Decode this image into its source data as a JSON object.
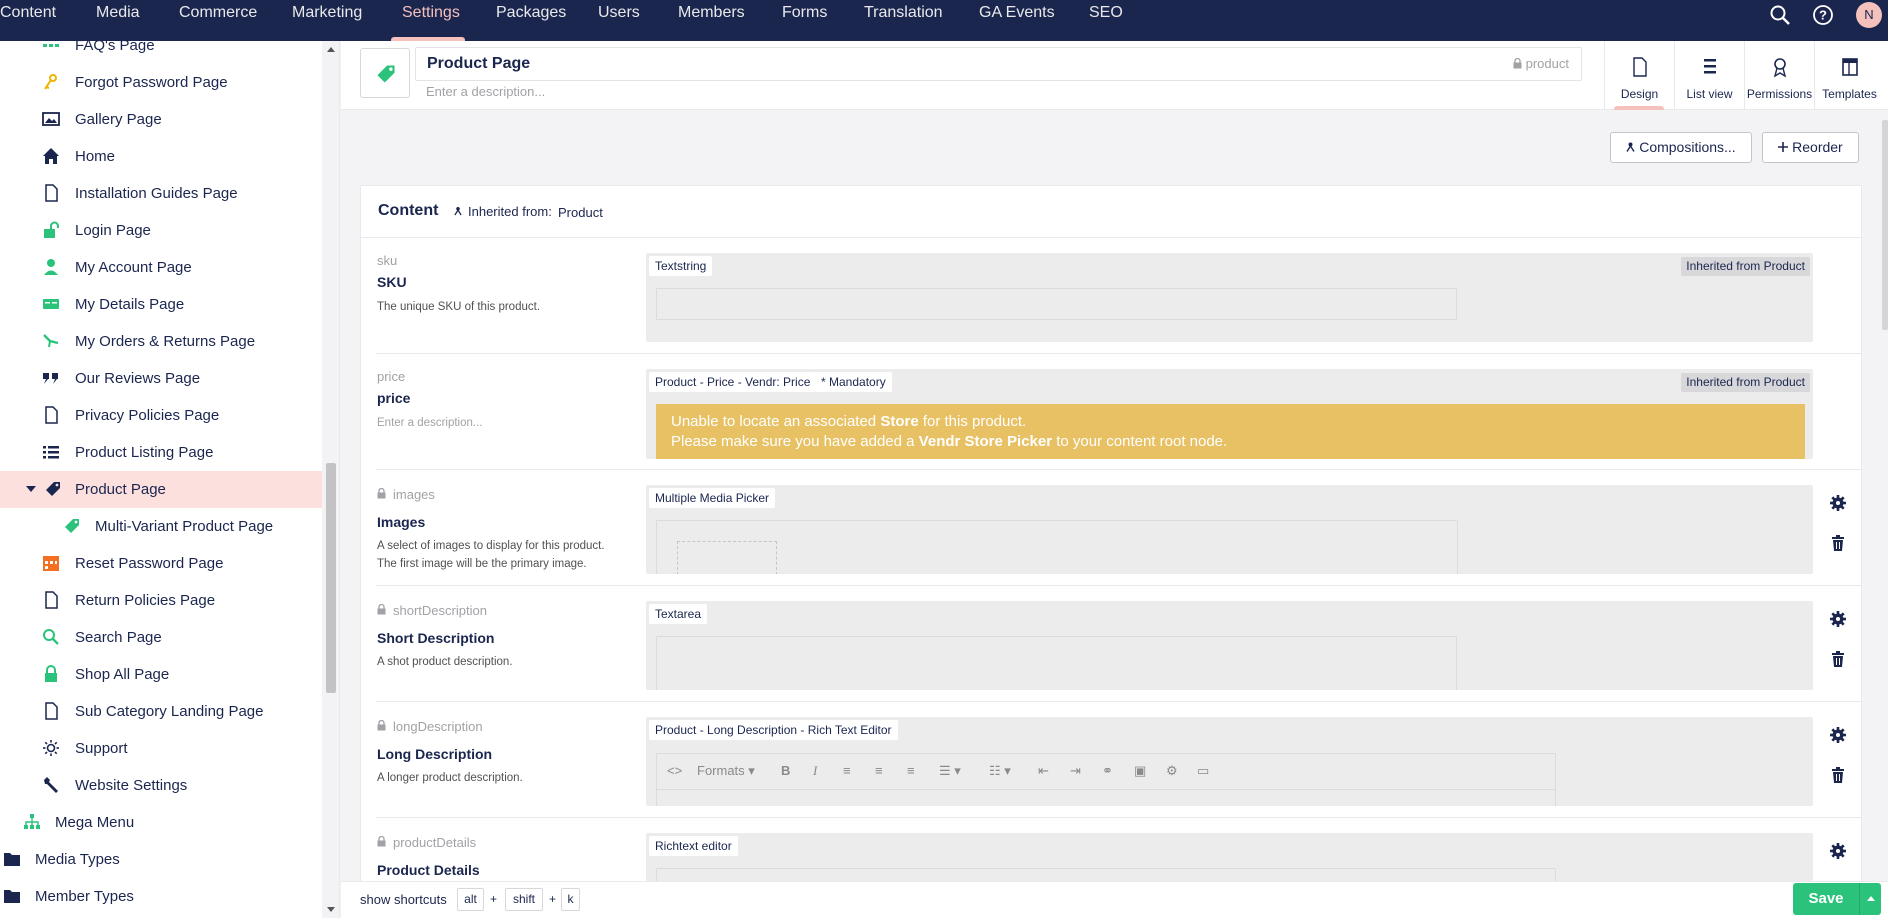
{
  "top_nav": {
    "items": [
      "Content",
      "Media",
      "Commerce",
      "Marketing",
      "Settings",
      "Packages",
      "Users",
      "Members",
      "Forms",
      "Translation",
      "GA Events",
      "SEO"
    ],
    "active": "Settings",
    "avatar_initial": "N"
  },
  "sidebar": {
    "items": [
      {
        "label": "FAQ's Page",
        "icon": "grid-icon"
      },
      {
        "label": "Forgot Password Page",
        "icon": "key-icon"
      },
      {
        "label": "Gallery Page",
        "icon": "picture-icon"
      },
      {
        "label": "Home",
        "icon": "home-icon"
      },
      {
        "label": "Installation Guides Page",
        "icon": "document-icon"
      },
      {
        "label": "Login Page",
        "icon": "unlock-icon"
      },
      {
        "label": "My Account Page",
        "icon": "user-icon"
      },
      {
        "label": "My Details Page",
        "icon": "id-card-icon"
      },
      {
        "label": "My Orders & Returns Page",
        "icon": "return-icon"
      },
      {
        "label": "Our Reviews Page",
        "icon": "quote-icon"
      },
      {
        "label": "Privacy Policies Page",
        "icon": "document-icon"
      },
      {
        "label": "Product Listing Page",
        "icon": "list-icon"
      },
      {
        "label": "Product Page",
        "icon": "tag-icon"
      },
      {
        "label": "Multi-Variant Product Page",
        "icon": "tags-icon"
      },
      {
        "label": "Reset Password Page",
        "icon": "calendar-icon"
      },
      {
        "label": "Return Policies Page",
        "icon": "document-icon"
      },
      {
        "label": "Search Page",
        "icon": "search-icon"
      },
      {
        "label": "Shop All Page",
        "icon": "lock-icon"
      },
      {
        "label": "Sub Category Landing Page",
        "icon": "document-icon"
      },
      {
        "label": "Support",
        "icon": "sun-icon"
      },
      {
        "label": "Website Settings",
        "icon": "wrench-icon"
      },
      {
        "label": "Mega Menu",
        "icon": "sitemap-icon"
      },
      {
        "label": "Media Types",
        "icon": "folder-icon"
      },
      {
        "label": "Member Types",
        "icon": "folder-icon"
      }
    ]
  },
  "header": {
    "name": "Product Page",
    "alias": "product",
    "description_placeholder": "Enter a description..."
  },
  "app_tabs": [
    "Design",
    "List view",
    "Permissions",
    "Templates"
  ],
  "toolbar": {
    "compositions": "Compositions...",
    "reorder": "Reorder"
  },
  "group": {
    "title": "Content",
    "inherited_label": "Inherited from:",
    "inherited_from": "Product"
  },
  "properties": [
    {
      "alias": "sku",
      "name": "SKU",
      "description": "The unique SKU of this product.",
      "editor": "Textstring",
      "inherited": "Inherited from Product"
    },
    {
      "alias": "price",
      "name": "price",
      "description": "Enter a description...",
      "editor": "Product - Price - Vendr: Price",
      "mandatory": "* Mandatory",
      "inherited": "Inherited from Product",
      "warning": {
        "l1a": "Unable to locate an associated ",
        "l1b": "Store",
        "l1c": " for this product.",
        "l2a": "Please make sure you have added a ",
        "l2b": "Vendr Store Picker",
        "l2c": " to your content root node."
      }
    },
    {
      "alias": "images",
      "name": "Images",
      "description": "A select of images to display for this product.",
      "description2": "The first image will be the primary image.",
      "editor": "Multiple Media Picker"
    },
    {
      "alias": "shortDescription",
      "name": "Short Description",
      "description": "A shot product description.",
      "editor": "Textarea"
    },
    {
      "alias": "longDescription",
      "name": "Long Description",
      "description": "A longer product description.",
      "editor": "Product - Long Description - Rich Text Editor",
      "formats": "Formats"
    },
    {
      "alias": "productDetails",
      "name": "Product Details",
      "editor": "Richtext editor"
    }
  ],
  "footer": {
    "shortcuts_label": "show shortcuts",
    "keys": [
      "alt",
      "shift",
      "k"
    ],
    "plus": "+",
    "save": "Save"
  },
  "colors": {
    "nav_bg": "#1b264f",
    "active": "#f5c1bc",
    "green": "#2bc37c",
    "warning": "#e8c164"
  }
}
